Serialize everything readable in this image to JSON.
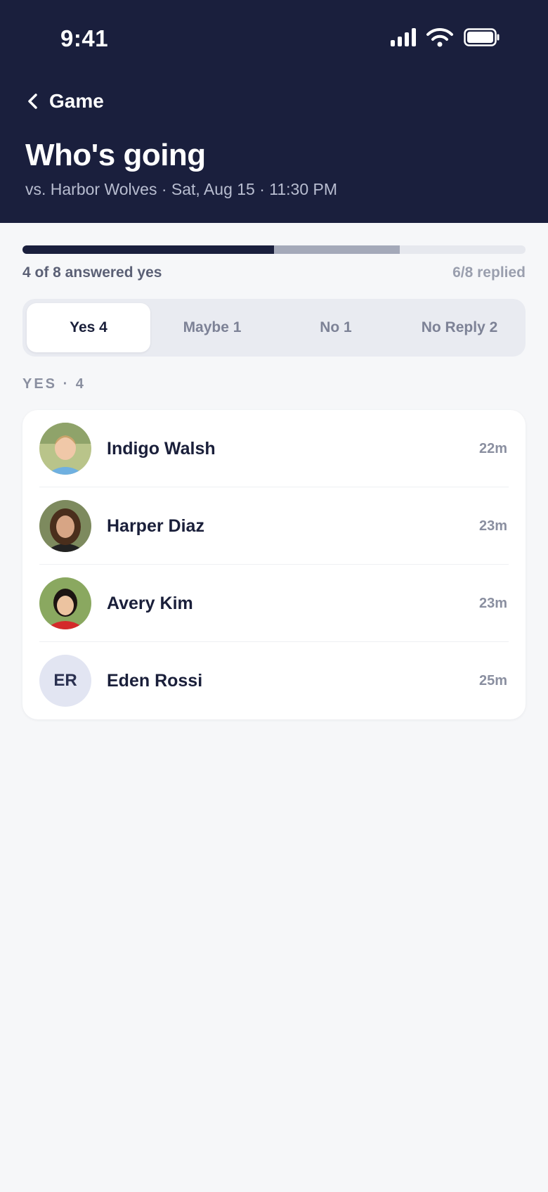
{
  "status_bar": {
    "time": "9:41"
  },
  "nav": {
    "back_label": "Game"
  },
  "header": {
    "title": "Who's going",
    "subtitle": "vs. Harbor Wolves · Sat, Aug 15 · 11:30 PM"
  },
  "progress": {
    "yes_count": 4,
    "replied_count": 6,
    "total": 8,
    "left_text": "4 of 8 answered yes",
    "right_text": "6/8 replied"
  },
  "tabs": [
    {
      "label": "Yes 4",
      "active": true
    },
    {
      "label": "Maybe 1",
      "active": false
    },
    {
      "label": "No 1",
      "active": false
    },
    {
      "label": "No Reply 2",
      "active": false
    }
  ],
  "section": {
    "label": "YES · 4"
  },
  "people": [
    {
      "name": "Indigo Walsh",
      "time": "22m",
      "avatar": "photo"
    },
    {
      "name": "Harper Diaz",
      "time": "23m",
      "avatar": "photo"
    },
    {
      "name": "Avery Kim",
      "time": "23m",
      "avatar": "photo"
    },
    {
      "name": "Eden Rossi",
      "time": "25m",
      "avatar": "initials",
      "initials": "ER"
    }
  ],
  "colors": {
    "header_bg": "#1a1f3d",
    "page_bg": "#f6f7f9",
    "progress_yes": "#1a1f3d",
    "progress_other": "#a4a9b9",
    "avatar_initials_bg": "#e2e5f2"
  }
}
